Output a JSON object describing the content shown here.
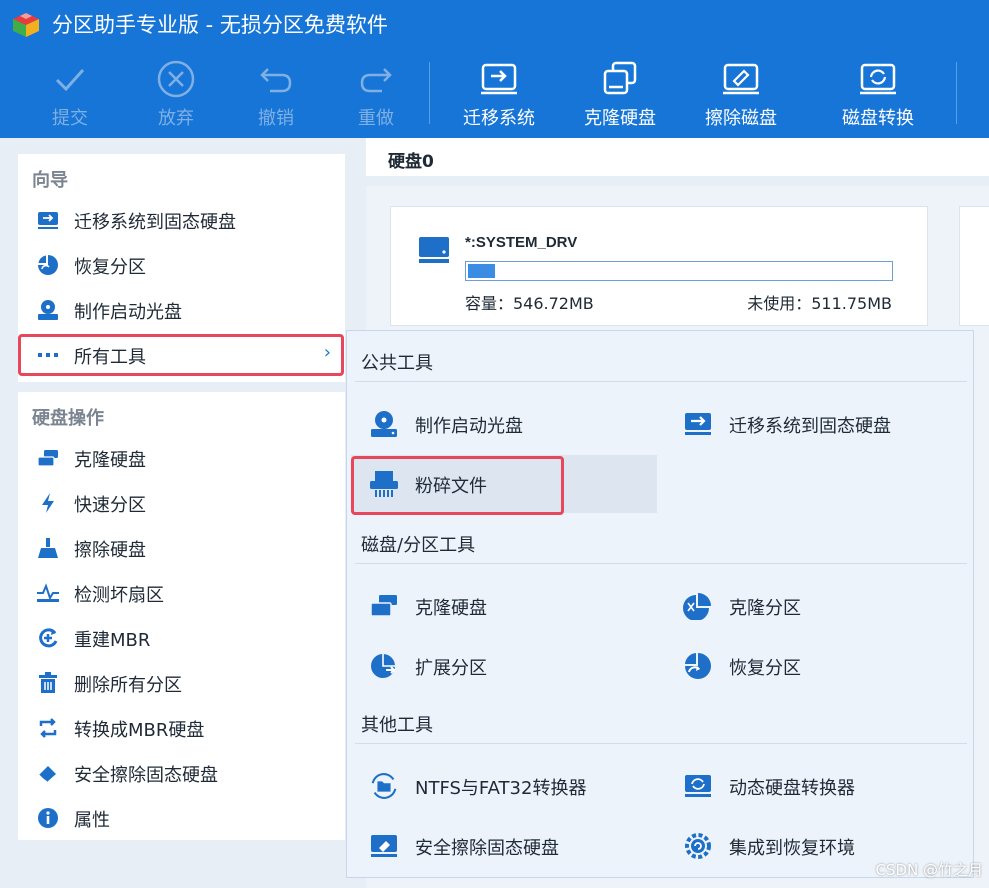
{
  "window": {
    "title": "分区助手专业版 - 无损分区免费软件"
  },
  "toolbar": {
    "commit": "提交",
    "discard": "放弃",
    "undo": "撤销",
    "redo": "重做",
    "migrate_os": "迁移系统",
    "clone_disk": "克隆硬盘",
    "wipe_disk": "擦除磁盘",
    "disk_convert": "磁盘转换"
  },
  "sidebar": {
    "wizard_title": "向导",
    "wizard_items": [
      {
        "label": "迁移系统到固态硬盘"
      },
      {
        "label": "恢复分区"
      },
      {
        "label": "制作启动光盘"
      },
      {
        "label": "所有工具"
      }
    ],
    "disk_ops_title": "硬盘操作",
    "disk_items": [
      {
        "label": "克隆硬盘"
      },
      {
        "label": "快速分区"
      },
      {
        "label": "擦除硬盘"
      },
      {
        "label": "检测坏扇区"
      },
      {
        "label": "重建MBR"
      },
      {
        "label": "删除所有分区"
      },
      {
        "label": "转换成MBR硬盘"
      },
      {
        "label": "安全擦除固态硬盘"
      },
      {
        "label": "属性"
      }
    ]
  },
  "disk": {
    "header": "硬盘0",
    "partition": {
      "name": "*:SYSTEM_DRV",
      "capacity": "容量：546.72MB",
      "free": "未使用：511.75MB",
      "used_fraction": 0.064
    }
  },
  "menu": {
    "common_title": "公共工具",
    "common_items": [
      {
        "label": "制作启动光盘"
      },
      {
        "label": "迁移系统到固态硬盘"
      },
      {
        "label": "粉碎文件"
      }
    ],
    "disk_tools_title": "磁盘/分区工具",
    "disk_tools_items": [
      {
        "label": "克隆硬盘"
      },
      {
        "label": "克隆分区"
      },
      {
        "label": "扩展分区"
      },
      {
        "label": "恢复分区"
      }
    ],
    "other_title": "其他工具",
    "other_items": [
      {
        "label": "NTFS与FAT32转换器"
      },
      {
        "label": "动态硬盘转换器"
      },
      {
        "label": "安全擦除固态硬盘"
      },
      {
        "label": "集成到恢复环境"
      }
    ]
  },
  "watermark": "CSDN @竹之月",
  "colors": {
    "accent": "#1675d6",
    "highlight": "#e8465a",
    "icon": "#1e6fc7"
  }
}
